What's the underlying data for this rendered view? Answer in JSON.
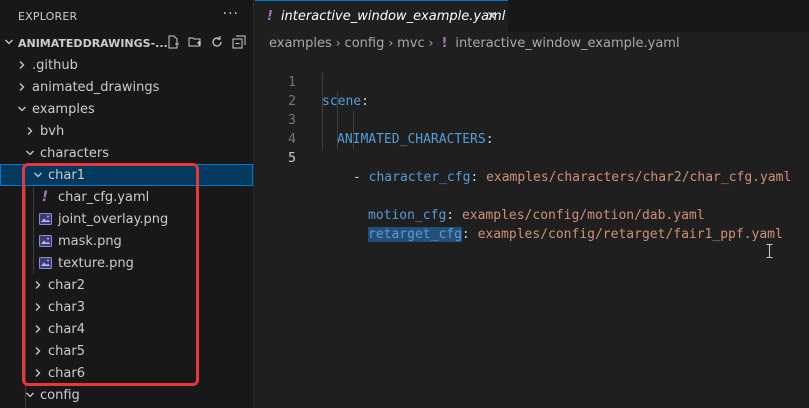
{
  "explorer": {
    "title": "EXPLORER",
    "more_label": "···",
    "folder_name": "ANIMATEDDRAWINGS-...",
    "tree": [
      {
        "label": ".github",
        "type": "folder",
        "expanded": false,
        "depth": 1
      },
      {
        "label": "animated_drawings",
        "type": "folder",
        "expanded": false,
        "depth": 1
      },
      {
        "label": "examples",
        "type": "folder",
        "expanded": true,
        "depth": 1
      },
      {
        "label": "bvh",
        "type": "folder",
        "expanded": false,
        "depth": 2
      },
      {
        "label": "characters",
        "type": "folder",
        "expanded": true,
        "depth": 2
      },
      {
        "label": "char1",
        "type": "folder",
        "expanded": true,
        "depth": 3,
        "selected": true
      },
      {
        "label": "char_cfg.yaml",
        "type": "yaml",
        "depth": 4
      },
      {
        "label": "joint_overlay.png",
        "type": "image",
        "depth": 4
      },
      {
        "label": "mask.png",
        "type": "image",
        "depth": 4
      },
      {
        "label": "texture.png",
        "type": "image",
        "depth": 4
      },
      {
        "label": "char2",
        "type": "folder",
        "expanded": false,
        "depth": 3
      },
      {
        "label": "char3",
        "type": "folder",
        "expanded": false,
        "depth": 3
      },
      {
        "label": "char4",
        "type": "folder",
        "expanded": false,
        "depth": 3
      },
      {
        "label": "char5",
        "type": "folder",
        "expanded": false,
        "depth": 3
      },
      {
        "label": "char6",
        "type": "folder",
        "expanded": false,
        "depth": 3
      },
      {
        "label": "config",
        "type": "folder",
        "expanded": true,
        "depth": 2
      }
    ]
  },
  "tab": {
    "filename": "interactive_window_example.yaml",
    "icon": "yaml-exclamation-icon",
    "close_icon": "close-icon"
  },
  "breadcrumb": {
    "items": [
      "examples",
      "config",
      "mvc"
    ],
    "file": "interactive_window_example.yaml"
  },
  "code": {
    "lines": [
      {
        "num": "1",
        "key": "scene",
        "colon": ":",
        "value": ""
      },
      {
        "num": "2",
        "key": "ANIMATED_CHARACTERS",
        "colon": ":",
        "value": ""
      },
      {
        "num": "3",
        "prefix": "- ",
        "key": "character_cfg",
        "colon": ": ",
        "value": "examples/characters/char2/char_cfg.yaml"
      },
      {
        "num": "4",
        "key": "motion_cfg",
        "colon": ": ",
        "value": "examples/config/motion/dab.yaml"
      },
      {
        "num": "5",
        "key": "retarget_cfg",
        "colon": ": ",
        "value": "examples/config/retarget/fair1_ppf.yaml"
      }
    ],
    "active_line": "5"
  },
  "colors": {
    "accent": "#0078d4",
    "highlight_box": "#e5383b",
    "yaml_key": "#569cd6",
    "yaml_value": "#ce9178",
    "yaml_icon": "#a074c4"
  }
}
